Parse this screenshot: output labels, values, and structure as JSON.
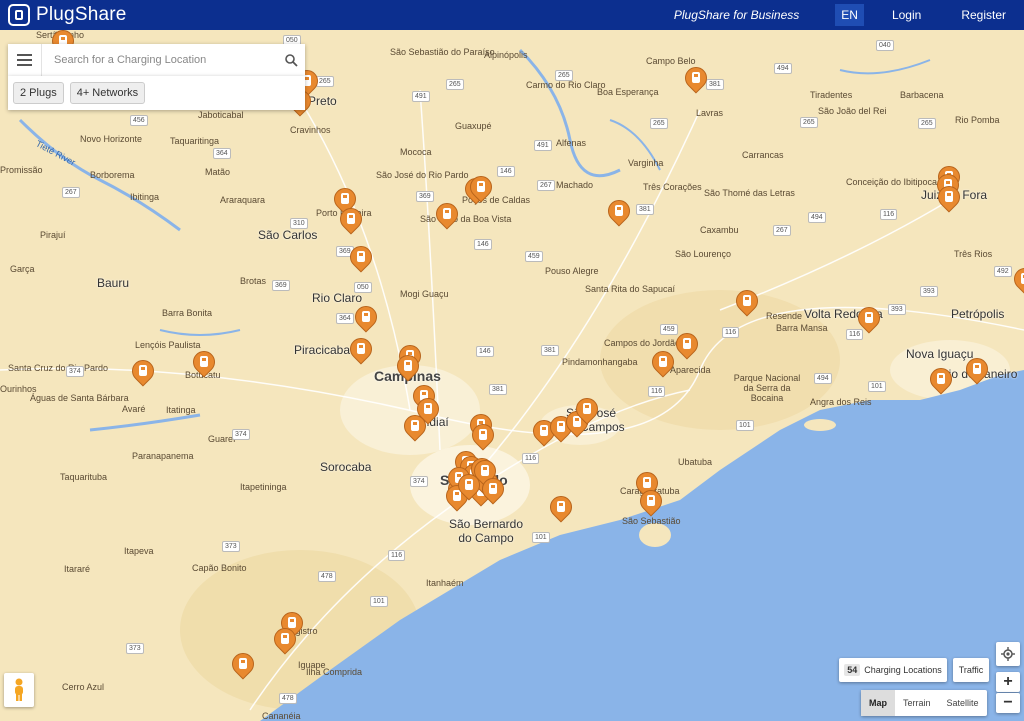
{
  "header": {
    "brand": "PlugShare",
    "business_link": "PlugShare for Business",
    "language": "EN",
    "login": "Login",
    "register": "Register",
    "bg_color": "#0c2f8f"
  },
  "search": {
    "placeholder": "Search for a Charging Location"
  },
  "filters": [
    "2 Plugs",
    "4+ Networks"
  ],
  "map": {
    "cities": [
      {
        "name": "São Carlos",
        "big": false
      },
      {
        "name": "Bauru",
        "big": false
      },
      {
        "name": "Rio Claro",
        "big": false
      },
      {
        "name": "Piracicaba",
        "big": false
      },
      {
        "name": "Campinas",
        "big": true
      },
      {
        "name": "Jundiaí",
        "big": false
      },
      {
        "name": "Sorocaba",
        "big": false
      },
      {
        "name": "São Paulo",
        "big": true
      },
      {
        "name": "São Bernardo do Campo",
        "big": false
      },
      {
        "name": "São José dos Campos",
        "big": false
      },
      {
        "name": "Volta Redonda",
        "big": false
      },
      {
        "name": "Petrópolis",
        "big": false
      },
      {
        "name": "Nova Iguaçu",
        "big": false
      },
      {
        "name": "Rio de Janeiro",
        "big": false
      },
      {
        "name": "Juiz de Fora",
        "big": false
      },
      {
        "name": "Ribeirão Preto",
        "big": false
      }
    ],
    "places": [
      "Sertãozinho",
      "São Sebastião do Paraíso",
      "Alpinópolis",
      "Campo Belo",
      "Novo Horizonte",
      "Jaboticabal",
      "Cravinhos",
      "Guaxupé",
      "Carmo do Rio Claro",
      "Boa Esperança",
      "Lavras",
      "Tiradentes",
      "São João del Rei",
      "Barbacena",
      "Rio Pomba",
      "Taquaritinga",
      "Mococa",
      "Alfenas",
      "Varginha",
      "Carrancas",
      "Promissão",
      "Borborema",
      "Matão",
      "São José do Rio Pardo",
      "Machado",
      "Três Corações",
      "São Thomé das Letras",
      "Conceição do Ibitipoca",
      "Ibitinga",
      "Araraquara",
      "Porto Ferreira",
      "São João da Boa Vista",
      "Poços de Caldas",
      "Caxambu",
      "Pirajuí",
      "Mogi Guaçu",
      "Pouso Alegre",
      "São Lourenço",
      "Três Rios",
      "Garça",
      "Brotas",
      "Santa Rita do Sapucaí",
      "Barra Bonita",
      "Resende",
      "Barra Mansa",
      "Lençóis Paulista",
      "Campos do Jordão",
      "Santa Cruz do Rio Pardo",
      "Botucatu",
      "Pindamonhangaba",
      "Aparecida",
      "Parque Nacional da Serra da Bocaina",
      "Angra dos Reis",
      "Ourinhos",
      "Avaré",
      "Itatinga",
      "Paranapanema",
      "Ubatuba",
      "Taquarituba",
      "Itapetininga",
      "Caraguatatuba",
      "São Sebastião",
      "Itapeva",
      "Capão Bonito",
      "Itararé",
      "Itanhaém",
      "Registro",
      "Cerro Azul",
      "Ilha Comprida",
      "Cananéia",
      "Iguape",
      "Águas de Santa Bárbara",
      "Guareí"
    ],
    "river_label": "Tietê River",
    "land_color": "#f5e6bd",
    "water_color": "#8ab4e8",
    "pin_color": "#e8892f",
    "pin_count": 54
  },
  "controls": {
    "count": "54",
    "count_label": "Charging Locations",
    "traffic": "Traffic",
    "maptypes": [
      "Map",
      "Terrain",
      "Satellite"
    ],
    "active_maptype": "Map",
    "zoom_in": "+",
    "zoom_out": "−"
  }
}
